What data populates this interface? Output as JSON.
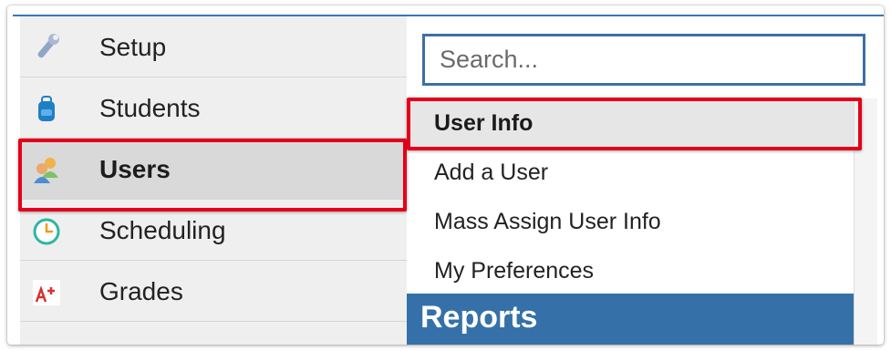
{
  "sidebar": {
    "items": [
      {
        "label": "Setup",
        "icon": "wrench-icon"
      },
      {
        "label": "Students",
        "icon": "student-backpack-icon"
      },
      {
        "label": "Users",
        "icon": "users-icon",
        "active": true
      },
      {
        "label": "Scheduling",
        "icon": "clock-icon"
      },
      {
        "label": "Grades",
        "icon": "grade-a-plus-icon"
      }
    ]
  },
  "flyout": {
    "search": {
      "placeholder": "Search..."
    },
    "items": [
      {
        "label": "User Info",
        "active": true
      },
      {
        "label": "Add a User"
      },
      {
        "label": "Mass Assign User Info"
      },
      {
        "label": "My Preferences"
      }
    ],
    "section_header": "Reports"
  },
  "colors": {
    "highlight_box": "#e4001b",
    "section_header_bg": "#3571a8",
    "search_border": "#3c6fa6"
  }
}
